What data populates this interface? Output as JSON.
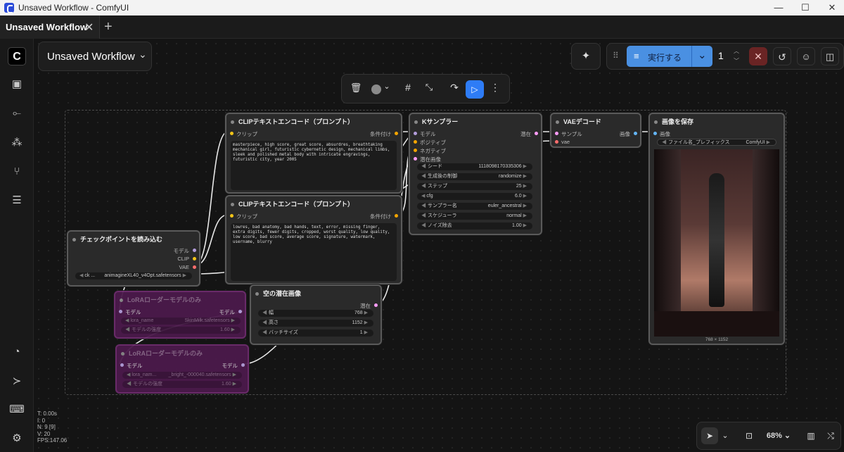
{
  "window": {
    "title": "Unsaved Workflow - ComfyUI",
    "min": "—",
    "max": "☐",
    "close": "✕"
  },
  "tabs": [
    {
      "label": "Unsaved Workflow",
      "close": "✕"
    }
  ],
  "tab_add": "+",
  "workflow_menu": {
    "label": "Unsaved Workflow",
    "caret": "⌄"
  },
  "queue": {
    "run_label": "実行する",
    "count": "1",
    "caret": "⌄"
  },
  "selection_toolbox": {
    "color_caret": "⌄",
    "more": "⋮"
  },
  "nodes": {
    "clip1": {
      "title": "CLIPテキストエンコード（プロンプト）",
      "input": "クリップ",
      "output": "条件付け",
      "text": "masterpiece, high score, great score, absurdres, breathtaking mechanical girl, futuristic cybernetic design, mechanical limbs, sleek and polished metal body with intricate engravings, futuristic city, year 2005"
    },
    "clip2": {
      "title": "CLIPテキストエンコード（プロンプト）",
      "input": "クリップ",
      "output": "条件付け",
      "text": "lowres, bad anatomy, bad hands, text, error, missing finger, extra digits, fewer digits, cropped, worst quality, low quality, low score, bad score, average score, signature, watermark, username, blurry"
    },
    "ksampler": {
      "title": "Kサンプラー",
      "inputs": [
        "モデル",
        "ポジティブ",
        "ネガティブ",
        "潜在画像"
      ],
      "output": "潜在",
      "widgets": [
        {
          "label": "シード",
          "value": "1118098170335306"
        },
        {
          "label": "生成後の制御",
          "value": "randomize"
        },
        {
          "label": "ステップ",
          "value": "25"
        },
        {
          "label": "cfg",
          "value": "6.0"
        },
        {
          "label": "サンプラー名",
          "value": "euler_ancestral"
        },
        {
          "label": "スケジューラ",
          "value": "normal"
        },
        {
          "label": "ノイズ除去",
          "value": "1.00"
        }
      ]
    },
    "vae": {
      "title": "VAEデコード",
      "inputs": [
        "サンプル",
        "vae"
      ],
      "output": "画像"
    },
    "save": {
      "title": "画像を保存",
      "input": "画像",
      "widget_label": "ファイル名_プレフィックス",
      "widget_value": "ComfyUI",
      "image_size": "768 × 1152"
    },
    "checkpoint": {
      "title": "チェックポイントを読み込む",
      "outputs": [
        "モデル",
        "CLIP",
        "VAE"
      ],
      "widget_label": "ck ...",
      "widget_value": "animagineXL40_v4Opt.safetensors"
    },
    "latent": {
      "title": "空の潜在画像",
      "output": "潜在",
      "widgets": [
        {
          "label": "幅",
          "value": "768"
        },
        {
          "label": "高さ",
          "value": "1152"
        },
        {
          "label": "バッチサイズ",
          "value": "1"
        }
      ]
    },
    "lora1": {
      "title": "LoRAローダーモデルのみ",
      "input": "モデル",
      "output": "モデル",
      "w1_label": "lora_name",
      "w1_value": "SkinMilk.safetensors",
      "w2_label": "モデルの強度",
      "w2_value": "1.60"
    },
    "lora2": {
      "title": "LoRAローダーモデルのみ",
      "input": "モデル",
      "output": "モデル",
      "w1_label": "lora_nam...",
      "w1_value": "_bright_-000040.safetensors",
      "w2_label": "モデルの強度",
      "w2_value": "1.60"
    }
  },
  "stats": [
    "T: 0.00s",
    "I: 0",
    "N: 9 [9]",
    "V: 20",
    "FPS:147.06"
  ],
  "zoom": "68%",
  "colors": {
    "accent": "#2e7cf6",
    "run": "#4a90e2",
    "lora": "#4b1a4b",
    "danger": "#8b2a2a"
  }
}
